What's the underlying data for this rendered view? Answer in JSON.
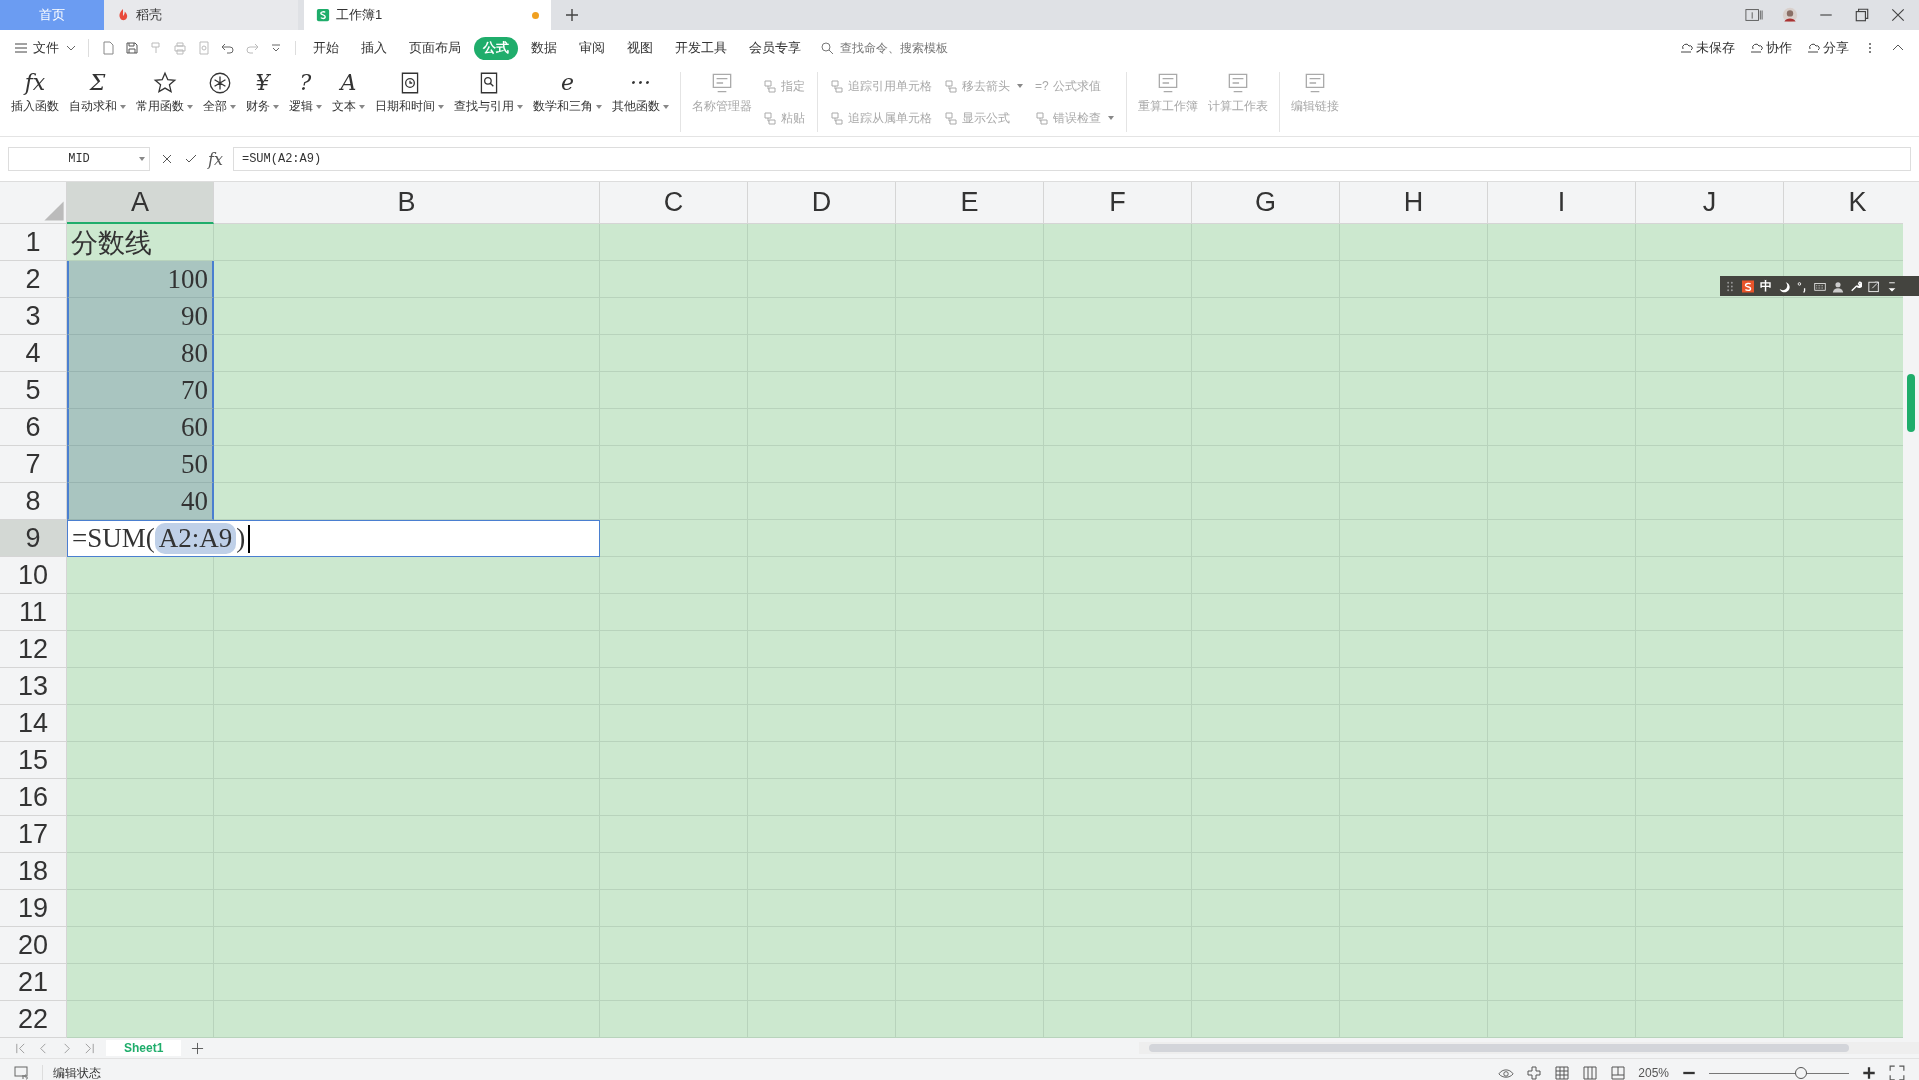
{
  "tabs": [
    {
      "label": "首页",
      "selected": false,
      "kind": "home"
    },
    {
      "label": "稻壳",
      "selected": false,
      "kind": "docer"
    },
    {
      "label": "工作簿1",
      "selected": true,
      "kind": "sheet",
      "modified": true
    }
  ],
  "menu": {
    "file": "文件",
    "tabs": [
      {
        "label": "开始",
        "selected": false
      },
      {
        "label": "插入",
        "selected": false
      },
      {
        "label": "页面布局",
        "selected": false
      },
      {
        "label": "公式",
        "selected": true
      },
      {
        "label": "数据",
        "selected": false
      },
      {
        "label": "审阅",
        "selected": false
      },
      {
        "label": "视图",
        "selected": false
      },
      {
        "label": "开发工具",
        "selected": false
      },
      {
        "label": "会员专享",
        "selected": false
      }
    ],
    "search_placeholder": "查找命令、搜索模板",
    "actions": [
      "未保存",
      "协作",
      "分享"
    ]
  },
  "ribbon": [
    {
      "kind": "large",
      "label": "插入函数",
      "glyph": "fx",
      "dropdown": false,
      "disabled": false
    },
    {
      "kind": "large",
      "label": "自动求和",
      "glyph": "Σ",
      "dropdown": true,
      "disabled": false
    },
    {
      "kind": "large",
      "label": "常用函数",
      "dropdown": true,
      "disabled": false
    },
    {
      "kind": "large",
      "label": "全部",
      "dropdown": true,
      "disabled": false
    },
    {
      "kind": "large",
      "label": "财务",
      "glyph": "¥",
      "dropdown": true,
      "disabled": false
    },
    {
      "kind": "large",
      "label": "逻辑",
      "glyph": "?",
      "dropdown": true,
      "disabled": false
    },
    {
      "kind": "large",
      "label": "文本",
      "glyph": "A",
      "dropdown": true,
      "disabled": false
    },
    {
      "kind": "large",
      "label": "日期和时间",
      "dropdown": true,
      "disabled": false
    },
    {
      "kind": "large",
      "label": "查找与引用",
      "dropdown": true,
      "disabled": false
    },
    {
      "kind": "large",
      "label": "数学和三角",
      "glyph": "e",
      "dropdown": true,
      "disabled": false
    },
    {
      "kind": "large",
      "label": "其他函数",
      "glyph": "···",
      "dropdown": true,
      "disabled": false
    },
    {
      "kind": "separator"
    },
    {
      "kind": "large",
      "label": "名称管理器",
      "dropdown": false,
      "disabled": true
    },
    {
      "kind": "stack",
      "items": [
        {
          "label": "指定",
          "dropdown": false,
          "disabled": true
        },
        {
          "label": "粘贴",
          "dropdown": false,
          "disabled": true
        }
      ]
    },
    {
      "kind": "separator"
    },
    {
      "kind": "stack",
      "items": [
        {
          "label": "追踪引用单元格",
          "dropdown": false,
          "disabled": true
        },
        {
          "label": "追踪从属单元格",
          "dropdown": false,
          "disabled": true
        }
      ]
    },
    {
      "kind": "stack",
      "items": [
        {
          "label": "移去箭头",
          "dropdown": true,
          "disabled": true
        },
        {
          "label": "显示公式",
          "dropdown": false,
          "disabled": true
        }
      ]
    },
    {
      "kind": "stack",
      "items": [
        {
          "label": "公式求值",
          "glyph": "=?",
          "dropdown": false,
          "disabled": true
        },
        {
          "label": "错误检查",
          "dropdown": true,
          "disabled": true
        }
      ]
    },
    {
      "kind": "separator"
    },
    {
      "kind": "large",
      "label": "重算工作簿",
      "dropdown": false,
      "disabled": true
    },
    {
      "kind": "large",
      "label": "计算工作表",
      "dropdown": false,
      "disabled": true
    },
    {
      "kind": "separator"
    },
    {
      "kind": "large",
      "label": "编辑链接",
      "dropdown": false,
      "disabled": true
    }
  ],
  "formula_bar": {
    "name_box": "MID",
    "fx": "fx",
    "formula": "=SUM(A2:A9)"
  },
  "columns": [
    {
      "label": "A",
      "selected": true
    },
    {
      "label": "B",
      "selected": false
    },
    {
      "label": "C",
      "selected": false
    },
    {
      "label": "D",
      "selected": false
    },
    {
      "label": "E",
      "selected": false
    },
    {
      "label": "F",
      "selected": false
    },
    {
      "label": "G",
      "selected": false
    },
    {
      "label": "H",
      "selected": false
    },
    {
      "label": "I",
      "selected": false
    },
    {
      "label": "J",
      "selected": false
    },
    {
      "label": "K",
      "selected": false
    }
  ],
  "rows": [
    {
      "label": "1",
      "active": false,
      "cell": {
        "kind": "text",
        "text": "分数线"
      }
    },
    {
      "label": "2",
      "active": false,
      "cell": {
        "kind": "number",
        "text": "100",
        "in_range": true
      }
    },
    {
      "label": "3",
      "active": false,
      "cell": {
        "kind": "number",
        "text": "90",
        "in_range": true
      }
    },
    {
      "label": "4",
      "active": false,
      "cell": {
        "kind": "number",
        "text": "80",
        "in_range": true
      }
    },
    {
      "label": "5",
      "active": false,
      "cell": {
        "kind": "number",
        "text": "70",
        "in_range": true
      }
    },
    {
      "label": "6",
      "active": false,
      "cell": {
        "kind": "number",
        "text": "60",
        "in_range": true
      }
    },
    {
      "label": "7",
      "active": false,
      "cell": {
        "kind": "number",
        "text": "50",
        "in_range": true
      }
    },
    {
      "label": "8",
      "active": false,
      "cell": {
        "kind": "number",
        "text": "40",
        "in_range": true
      }
    },
    {
      "label": "9",
      "active": true,
      "cell": {
        "kind": "editing",
        "before": "=SUM(",
        "ref": "A2:A9",
        "after": ")"
      }
    },
    {
      "label": "10",
      "active": false
    },
    {
      "label": "11",
      "active": false
    },
    {
      "label": "12",
      "active": false
    },
    {
      "label": "13",
      "active": false
    },
    {
      "label": "14",
      "active": false
    },
    {
      "label": "15",
      "active": false
    },
    {
      "label": "16",
      "active": false
    },
    {
      "label": "17",
      "active": false
    },
    {
      "label": "18",
      "active": false
    },
    {
      "label": "19",
      "active": false
    },
    {
      "label": "20",
      "active": false
    },
    {
      "label": "21",
      "active": false
    },
    {
      "label": "22",
      "active": false
    }
  ],
  "ime_toolbar": {
    "mode": "中"
  },
  "sheet_tabs": [
    {
      "label": "Sheet1",
      "selected": true
    }
  ],
  "status_bar": {
    "mode": "编辑状态",
    "zoom": "205%",
    "zoom_slider": {
      "level": 0.66
    }
  }
}
